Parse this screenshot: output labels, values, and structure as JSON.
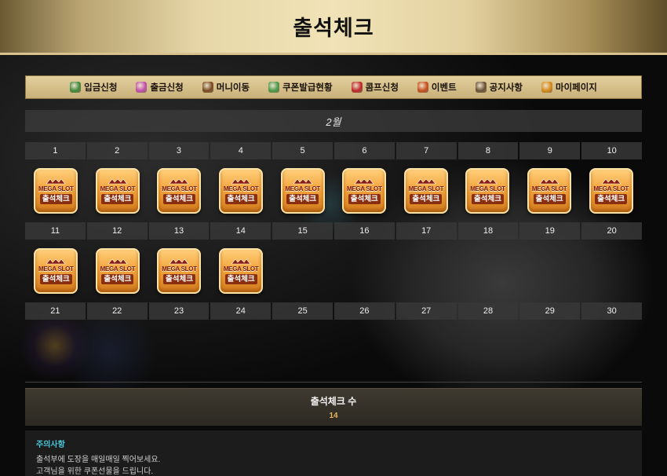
{
  "page": {
    "title": "출석체크"
  },
  "nav": [
    {
      "label": "입금신청",
      "icon": "money-bag-icon",
      "color": "#3f8a3a"
    },
    {
      "label": "출금신청",
      "icon": "coin-ring-icon",
      "color": "#c44fb0"
    },
    {
      "label": "머니이동",
      "icon": "chest-icon",
      "color": "#7a4a20"
    },
    {
      "label": "쿠폰발급현황",
      "icon": "gift-icon",
      "color": "#4a9a4a"
    },
    {
      "label": "콤프신청",
      "icon": "cherry-icon",
      "color": "#c0282a"
    },
    {
      "label": "이벤트",
      "icon": "star-icon",
      "color": "#c8501e"
    },
    {
      "label": "공지사항",
      "icon": "scroll-icon",
      "color": "#6a5238"
    },
    {
      "label": "마이페이지",
      "icon": "crown-icon",
      "color": "#d88a1a"
    }
  ],
  "calendar": {
    "month": "2월",
    "rows": [
      [
        "1",
        "2",
        "3",
        "4",
        "5",
        "6",
        "7",
        "8",
        "9",
        "10"
      ],
      [
        "11",
        "12",
        "13",
        "14",
        "15",
        "16",
        "17",
        "18",
        "19",
        "20"
      ],
      [
        "21",
        "22",
        "23",
        "24",
        "25",
        "26",
        "27",
        "28",
        "29",
        "30"
      ]
    ],
    "stamped_days_row1": 10,
    "stamped_days_row2": 4,
    "stamp": {
      "brand": "MEGA SLOT",
      "label": "출석체크"
    }
  },
  "count": {
    "title": "출석체크 수",
    "value": "14"
  },
  "notice": {
    "title": "주의사항",
    "lines": [
      "출석부에 도장을 매일매일 찍어보세요.",
      "고객님을 위한 쿠폰선물을 드립니다."
    ]
  },
  "colors": {
    "accent_gold": "#e4b45c",
    "notice_title": "#49c6d8"
  }
}
